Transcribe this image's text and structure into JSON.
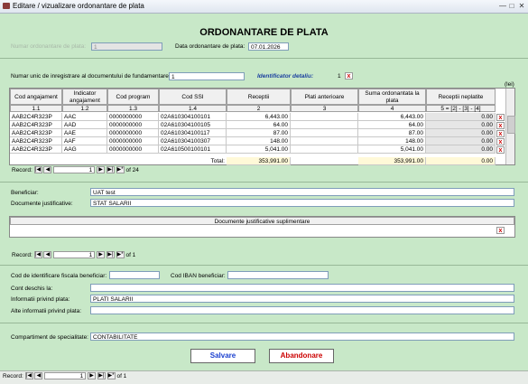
{
  "window": {
    "title": "Editare / vizualizare ordonantare de plata"
  },
  "form": {
    "heading": "ORDONANTARE DE PLATA",
    "nr_ordonantare_label": "Numar ordonantare de plata:",
    "nr_ordonantare_value": "1",
    "data_label": "Data ordonantare de plata:",
    "data_value": "07.01.2026",
    "nr_unic_label": "Numar unic de inregistrare al documentului de fundamentare:",
    "nr_unic_value": "1",
    "identificator_label": "Identificator detaliu:",
    "identificator_value": "1",
    "units_note": "(lei)"
  },
  "table": {
    "headers": [
      "Cod angajament",
      "Indicator angajament",
      "Cod program",
      "Cod SSI",
      "Receptii",
      "Plati anterioare",
      "Suma ordonantata la plata",
      "Receptii neplatite"
    ],
    "subheaders": [
      "1.1",
      "1.2",
      "1.3",
      "1.4",
      "2",
      "3",
      "4",
      "5 = [2] - [3] - [4]"
    ],
    "rows": [
      [
        "AAB2C4R323P",
        "AAC",
        "0000000000",
        "02A610304100101",
        "6,443.00",
        "",
        "6,443.00",
        "0.00"
      ],
      [
        "AAB2C4R323P",
        "AAD",
        "0000000000",
        "02A610304100105",
        "64.00",
        "",
        "64.00",
        "0.00"
      ],
      [
        "AAB2C4R323P",
        "AAE",
        "0000000000",
        "02A610304100117",
        "87.00",
        "",
        "87.00",
        "0.00"
      ],
      [
        "AAB2C4R323P",
        "AAF",
        "0000000000",
        "02A610304100307",
        "148.00",
        "",
        "148.00",
        "0.00"
      ],
      [
        "AAB2C4R323P",
        "AAG",
        "0000000000",
        "02A610500100101",
        "5,041.00",
        "",
        "5,041.00",
        "0.00"
      ]
    ],
    "total_label": "Total:",
    "total_receptii": "353,991.00",
    "total_suma": "353,991.00",
    "total_neplatite": "0.00",
    "nav": {
      "label": "Record:",
      "current": "1",
      "of": "of 24"
    }
  },
  "beneficiar": {
    "label": "Beneficiar:",
    "value": "UAT test"
  },
  "doc_just": {
    "label": "Documente justificative:",
    "value": "STAT SALARII"
  },
  "doc_supl": {
    "header": "Documente justificative suplimentare",
    "nav": {
      "label": "Record:",
      "current": "1",
      "of": "of 1"
    }
  },
  "fiscal": {
    "label": "Cod de identificare fiscala beneficiar:",
    "value": ""
  },
  "iban": {
    "label": "Cod IBAN beneficiar:",
    "value": ""
  },
  "cont": {
    "label": "Cont deschis la:",
    "value": ""
  },
  "info_plata": {
    "label": "Informatii privind plata:",
    "value": "PLATI SALARII"
  },
  "alte_info": {
    "label": "Alte informatii privind plata:",
    "value": ""
  },
  "compartiment": {
    "label": "Compartiment de specialitate:",
    "value": "CONTABILITATE"
  },
  "buttons": {
    "save": "Salvare",
    "cancel": "Abandonare",
    "delete": "x"
  },
  "bottom_nav": {
    "label": "Record:",
    "current": "1",
    "of": "of 1"
  },
  "colors": {
    "bg": "#c8e8c8",
    "save": "#1a3fcf",
    "cancel": "#cc0000"
  }
}
